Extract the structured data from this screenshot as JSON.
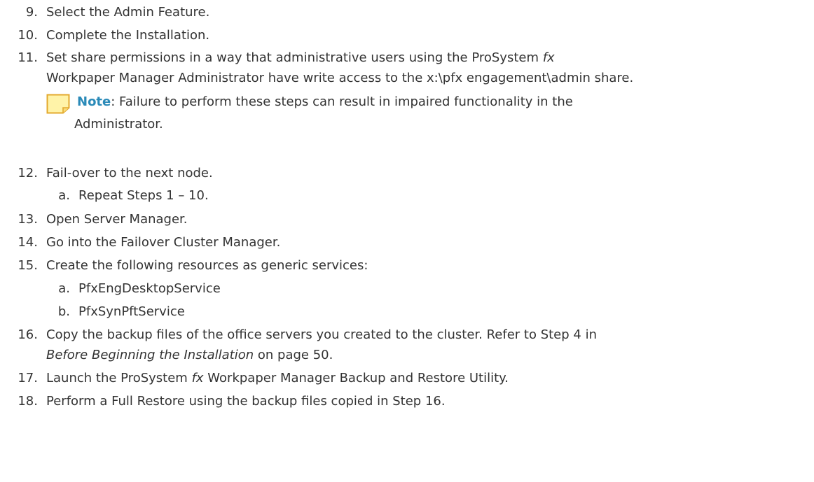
{
  "steps": [
    {
      "num": "9.",
      "text": "Select the Admin Feature."
    },
    {
      "num": "10.",
      "text": "Complete the Installation."
    },
    {
      "num": "11.",
      "line1_pre": "Set share permissions in a way that administrative users using the ProSystem ",
      "line1_em": "fx",
      "line2": "Workpaper Manager Administrator have write access to the x:\\pfx engagement\\admin share."
    },
    {
      "num": "12.",
      "text": "Fail-over to the next node."
    },
    {
      "num": "13.",
      "text": "Open Server Manager."
    },
    {
      "num": "14.",
      "text": "Go into the Failover Cluster Manager."
    },
    {
      "num": "15.",
      "text": "Create the following resources as generic services:"
    },
    {
      "num": "16.",
      "line1": "Copy the backup files of the office servers you created to the cluster. Refer to Step 4 in",
      "line2_em": "Before Beginning the Installation",
      "line2_post": " on page 50."
    },
    {
      "num": "17.",
      "pre": "Launch the ProSystem ",
      "em": "fx",
      "post": " Workpaper Manager Backup and Restore Utility."
    },
    {
      "num": "18.",
      "text": "Perform a Full Restore using the backup files copied in Step 16."
    }
  ],
  "note": {
    "label": "Note",
    "line1": ": Failure to perform these steps can result in impaired functionality in the",
    "line2": "Administrator.",
    "icon": "note-icon",
    "label_color": "#2a8ab8"
  },
  "substeps": {
    "step12": [
      {
        "num": "a.",
        "text": "Repeat Steps 1 – 10."
      }
    ],
    "step15": [
      {
        "num": "a.",
        "text": "PfxEngDesktopService"
      },
      {
        "num": "b.",
        "text": "PfxSynPftService"
      }
    ]
  }
}
